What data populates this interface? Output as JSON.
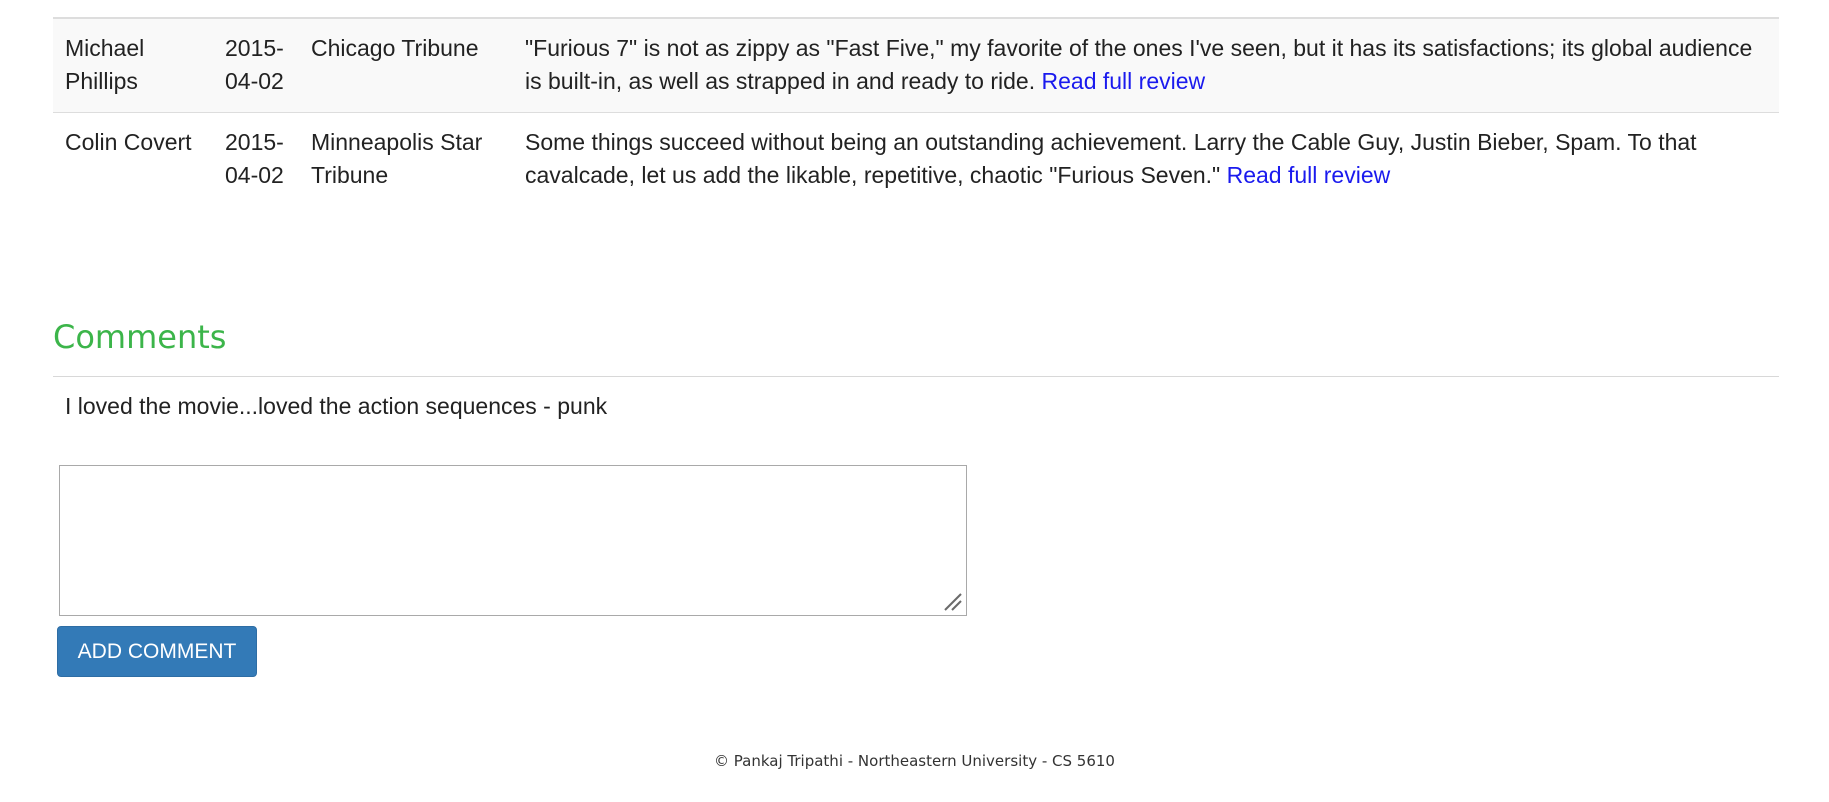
{
  "reviews": [
    {
      "critic": "Michael Phillips",
      "date": "2015-04-02",
      "publication": "Chicago Tribune",
      "quote": "\"Furious 7\" is not as zippy as \"Fast Five,\" my favorite of the ones I've seen, but it has its satisfactions; its global audience is built-in, as well as strapped in and ready to ride.",
      "link_label": "Read full review"
    },
    {
      "critic": "Colin Covert",
      "date": "2015-04-02",
      "publication": "Minneapolis Star Tribune",
      "quote": "Some things succeed without being an outstanding achievement. Larry the Cable Guy, Justin Bieber, Spam. To that cavalcade, let us add the likable, repetitive, chaotic \"Furious Seven.\"",
      "link_label": "Read full review"
    }
  ],
  "comments": {
    "heading": "Comments",
    "items": [
      "I loved the movie...loved the action sequences - punk"
    ],
    "new_comment_value": "",
    "add_button_label": "ADD COMMENT"
  },
  "footer": {
    "text": "© Pankaj Tripathi - Northeastern University - CS 5610"
  },
  "colors": {
    "heading": "#3cb54a",
    "link": "#1a1aee",
    "button": "#337ab7"
  },
  "icons": {
    "textarea_resize": "resize-grip-icon"
  }
}
